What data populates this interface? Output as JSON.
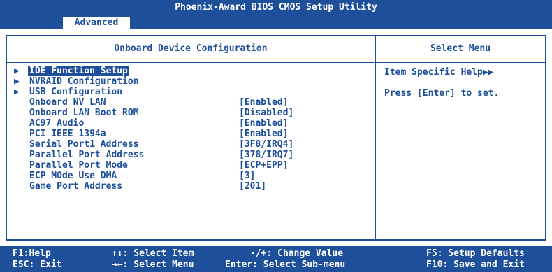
{
  "title": "Phoenix-Award BIOS CMOS Setup Utility",
  "tab": "Advanced",
  "left_header": "Onboard Device Configuration",
  "right_header": "Select Menu",
  "items": [
    {
      "label": "IDE Function Setup",
      "value": "",
      "submenu": true,
      "selected": true
    },
    {
      "label": "NVRAID Configuration",
      "value": "",
      "submenu": true
    },
    {
      "label": "USB Configuration",
      "value": "",
      "submenu": true
    },
    {
      "label": "Onboard NV LAN",
      "value": "[Enabled]"
    },
    {
      "label": "Onboard LAN Boot ROM",
      "value": "[Disabled]"
    },
    {
      "label": "AC97 Audio",
      "value": "[Enabled]"
    },
    {
      "label": "PCI IEEE 1394a",
      "value": "[Enabled]"
    },
    {
      "label": "Serial Port1 Address",
      "value": "[3F8/IRQ4]"
    },
    {
      "label": "Parallel Port Address",
      "value": "[378/IRQ7]"
    },
    {
      "label": "Parallel Port Mode",
      "value": "[ECP+EPP]"
    },
    {
      "label": "ECP MOde Use DMA",
      "value": "[3]"
    },
    {
      "label": "Game Port Address",
      "value": "[201]"
    }
  ],
  "help": {
    "title": "Item Specific Help▶▶",
    "text": "Press [Enter] to set."
  },
  "footer": {
    "f1": "F1:Help",
    "esc": "ESC: Exit",
    "select_item": "↑↓: Select Item",
    "select_menu": "→←: Select Menu",
    "change_value": "-/+: Change Value",
    "select_submenu": "Enter: Select Sub-menu",
    "f5": "F5: Setup Defaults",
    "f10": "F10: Save and Exit"
  },
  "colors": {
    "primary": "#1e4f9a",
    "background": "#ffffff"
  }
}
